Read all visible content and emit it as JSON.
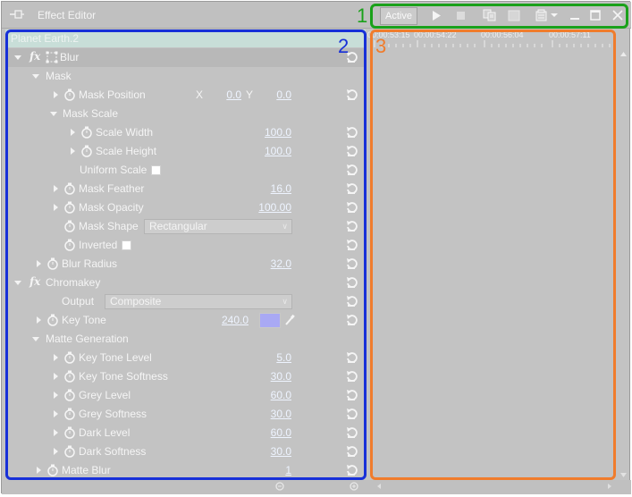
{
  "window": {
    "title": "Effect Editor"
  },
  "toolbar": {
    "active_label": "Active",
    "icons": [
      "pin-icon",
      "play-icon",
      "stop-icon",
      "copy-icon",
      "paste-icon",
      "preset-icon",
      "minimize-icon",
      "maximize-icon",
      "close-icon"
    ]
  },
  "annotations": {
    "n1": "1",
    "n2": "2",
    "n3": "3",
    "colors": {
      "n1": "#1aa11a",
      "n2": "#1730d8",
      "n3": "#f07c2c"
    }
  },
  "clip": {
    "name": "Planet Earth.2"
  },
  "timeline": {
    "labels": [
      "00:00:53:15",
      "00:00:54:22",
      "00:00:56:04",
      "00:00:57:11"
    ]
  },
  "effects": {
    "blur": {
      "name": "Blur",
      "mask": "Mask",
      "mask_position": {
        "label": "Mask Position",
        "x_label": "X",
        "x": "0.0",
        "y_label": "Y",
        "y": "0.0"
      },
      "mask_scale": "Mask Scale",
      "scale_width": {
        "label": "Scale Width",
        "value": "100.0"
      },
      "scale_height": {
        "label": "Scale Height",
        "value": "100.0"
      },
      "uniform_scale": {
        "label": "Uniform Scale"
      },
      "mask_feather": {
        "label": "Mask Feather",
        "value": "16.0"
      },
      "mask_opacity": {
        "label": "Mask Opacity",
        "value": "100.00"
      },
      "mask_shape": {
        "label": "Mask Shape",
        "value": "Rectangular"
      },
      "inverted": {
        "label": "Inverted"
      },
      "blur_radius": {
        "label": "Blur Radius",
        "value": "32.0"
      }
    },
    "chromakey": {
      "name": "Chromakey",
      "output": {
        "label": "Output",
        "value": "Composite"
      },
      "key_tone": {
        "label": "Key Tone",
        "value": "240.0",
        "color": "#a9a9f4"
      },
      "matte_generation": "Matte Generation",
      "key_tone_level": {
        "label": "Key Tone Level",
        "value": "5.0"
      },
      "key_tone_softness": {
        "label": "Key Tone Softness",
        "value": "30.0"
      },
      "grey_level": {
        "label": "Grey Level",
        "value": "60.0"
      },
      "grey_softness": {
        "label": "Grey Softness",
        "value": "30.0"
      },
      "dark_level": {
        "label": "Dark Level",
        "value": "60.0"
      },
      "dark_softness": {
        "label": "Dark Softness",
        "value": "30.0"
      },
      "matte_blur": {
        "label": "Matte Blur",
        "value": "1"
      }
    }
  }
}
